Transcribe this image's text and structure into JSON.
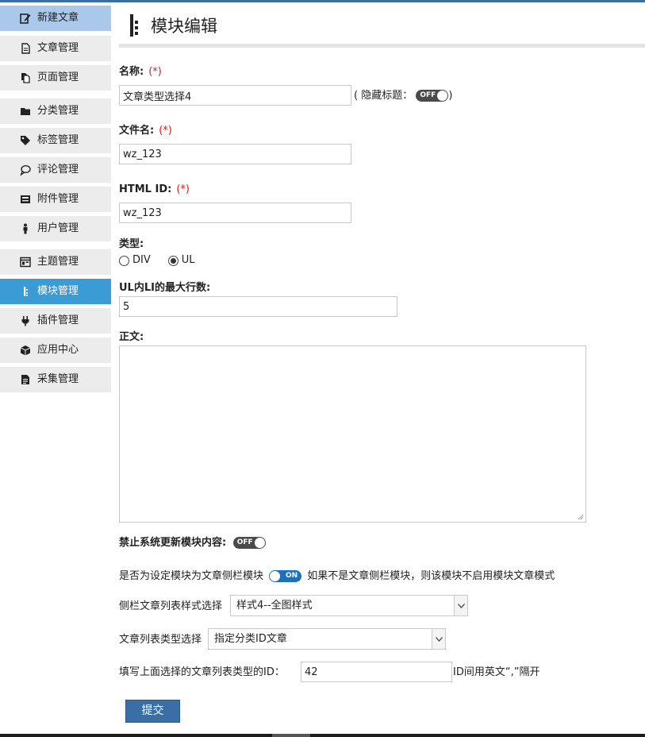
{
  "sidebar": {
    "items": [
      {
        "label": "新建文章",
        "icon": "edit-icon"
      },
      {
        "label": "文章管理",
        "icon": "document-icon"
      },
      {
        "label": "页面管理",
        "icon": "pages-icon"
      },
      {
        "label": "分类管理",
        "icon": "folder-icon"
      },
      {
        "label": "标签管理",
        "icon": "tag-icon"
      },
      {
        "label": "评论管理",
        "icon": "comment-icon"
      },
      {
        "label": "附件管理",
        "icon": "inbox-icon"
      },
      {
        "label": "用户管理",
        "icon": "user-icon"
      },
      {
        "label": "主题管理",
        "icon": "layout-icon"
      },
      {
        "label": "模块管理",
        "icon": "module-icon",
        "active": true
      },
      {
        "label": "插件管理",
        "icon": "plug-icon"
      },
      {
        "label": "应用中心",
        "icon": "cube-icon"
      },
      {
        "label": "采集管理",
        "icon": "file-icon"
      }
    ]
  },
  "page": {
    "title": "模块编辑"
  },
  "form": {
    "required_mark": "(*)",
    "name": {
      "label": "名称:",
      "value": "文章类型选择4"
    },
    "hide_title": {
      "prefix": "( 隐藏标题：",
      "suffix": ")",
      "toggle": "OFF"
    },
    "filename": {
      "label": "文件名:",
      "value": "wz_123"
    },
    "html_id": {
      "label": "HTML ID:",
      "value": "wz_123"
    },
    "type": {
      "label": "类型:",
      "options": [
        "DIV",
        "UL"
      ],
      "selected": "UL"
    },
    "max_rows": {
      "label": "UL内LI的最大行数:",
      "value": "5"
    },
    "content": {
      "label": "正文:",
      "value": ""
    },
    "no_update": {
      "label": "禁止系统更新模块内容:",
      "toggle": "OFF"
    },
    "sidebar_module": {
      "prefix": "是否为设定模块为文章侧栏模块",
      "toggle": "ON",
      "suffix": "如果不是文章侧栏模块，则该模块不启用模块文章模式"
    },
    "list_style": {
      "label": "侧栏文章列表样式选择",
      "value": "样式4--全图样式"
    },
    "list_type": {
      "label": "文章列表类型选择",
      "value": "指定分类ID文章"
    },
    "list_id": {
      "label": "填写上面选择的文章列表类型的ID：",
      "value": "42",
      "hint": "ID间用英文“,”隔开"
    },
    "submit_label": "提交"
  },
  "colors": {
    "accent": "#3a6ea5",
    "active_nav": "#3a9bd5",
    "first_nav": "#a9c8ea",
    "required": "#d21f1f"
  }
}
